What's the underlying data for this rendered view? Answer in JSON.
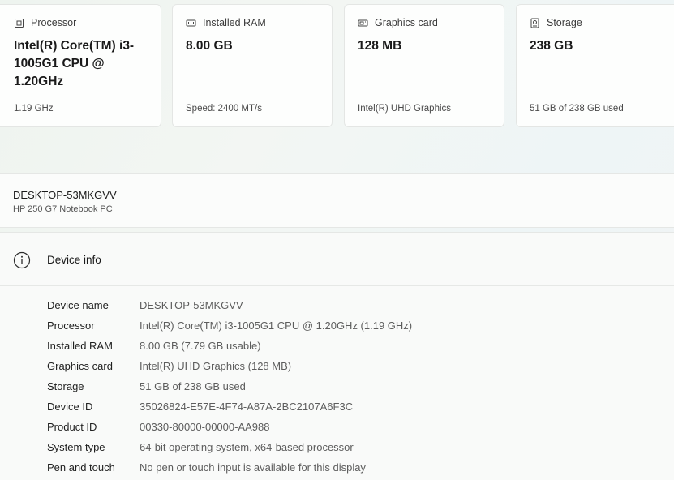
{
  "cards": [
    {
      "title": "Processor",
      "icon": "processor-icon",
      "value": "Intel(R) Core(TM) i3-1005G1 CPU @ 1.20GHz",
      "sub": "1.19 GHz"
    },
    {
      "title": "Installed RAM",
      "icon": "ram-icon",
      "value": "8.00 GB",
      "sub": "Speed: 2400 MT/s"
    },
    {
      "title": "Graphics card",
      "icon": "graphics-card-icon",
      "value": "128 MB",
      "sub": "Intel(R) UHD Graphics"
    },
    {
      "title": "Storage",
      "icon": "storage-icon",
      "value": "238 GB",
      "sub": "51 GB of 238 GB used"
    }
  ],
  "device": {
    "name": "DESKTOP-53MKGVV",
    "model": "HP 250 G7 Notebook PC"
  },
  "device_info": {
    "title": "Device info",
    "icon": "info-icon",
    "rows": [
      {
        "label": "Device name",
        "value": "DESKTOP-53MKGVV"
      },
      {
        "label": "Processor",
        "value": "Intel(R) Core(TM) i3-1005G1 CPU @ 1.20GHz (1.19 GHz)"
      },
      {
        "label": "Installed RAM",
        "value": "8.00 GB (7.79 GB usable)"
      },
      {
        "label": "Graphics card",
        "value": "Intel(R) UHD Graphics (128 MB)"
      },
      {
        "label": "Storage",
        "value": "51 GB of 238 GB used"
      },
      {
        "label": "Device ID",
        "value": "35026824-E57E-4F74-A87A-2BC2107A6F3C"
      },
      {
        "label": "Product ID",
        "value": "00330-80000-00000-AA988"
      },
      {
        "label": "System type",
        "value": "64-bit operating system, x64-based processor"
      },
      {
        "label": "Pen and touch",
        "value": "No pen or touch input is available for this display"
      }
    ]
  }
}
